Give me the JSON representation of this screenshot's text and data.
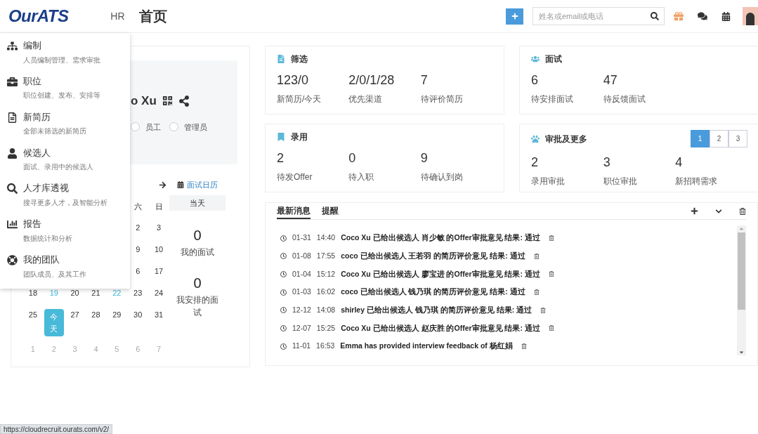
{
  "header": {
    "brand": "OurATS",
    "role": "HR",
    "title": "首页",
    "search": {
      "placeholder": "姓名或email或电话"
    }
  },
  "menu": [
    {
      "title": "编制",
      "subtitle": "人员编制管理、需求审批"
    },
    {
      "title": "职位",
      "subtitle": "职位创建、发布、安排等"
    },
    {
      "title": "新简历",
      "subtitle": "全部未筛选的新简历"
    },
    {
      "title": "候选人",
      "subtitle": "面试、录用中的候选人"
    },
    {
      "title": "人才库透视",
      "subtitle": "搜寻更多人才，及智能分析"
    },
    {
      "title": "报告",
      "subtitle": "数据统计和分析"
    },
    {
      "title": "我的团队",
      "subtitle": "团队成员、及其工作"
    }
  ],
  "profile": {
    "name": "o Xu",
    "roles": [
      {
        "label": "员工",
        "selected": false
      },
      {
        "label": "管理员",
        "selected": false
      }
    ]
  },
  "calendar": {
    "weekdays": [
      "六",
      "日"
    ],
    "weeks": [
      [
        {
          "day": "2",
          "kind": "normal"
        },
        {
          "day": "3",
          "kind": "normal"
        }
      ],
      [
        {
          "day": "9",
          "kind": "normal"
        },
        {
          "day": "10",
          "kind": "normal"
        }
      ],
      [
        {
          "day": "6",
          "kind": "normal"
        },
        {
          "day": "17",
          "kind": "normal"
        }
      ],
      [
        {
          "day": "18",
          "kind": "normal"
        },
        {
          "day": "19",
          "kind": "marked"
        },
        {
          "day": "20",
          "kind": "normal"
        },
        {
          "day": "21",
          "kind": "normal"
        },
        {
          "day": "22",
          "kind": "marked"
        },
        {
          "day": "23",
          "kind": "normal"
        },
        {
          "day": "24",
          "kind": "normal"
        }
      ],
      [
        {
          "day": "25",
          "kind": "normal"
        },
        {
          "day": "今天",
          "kind": "today"
        },
        {
          "day": "27",
          "kind": "normal"
        },
        {
          "day": "28",
          "kind": "normal"
        },
        {
          "day": "29",
          "kind": "normal"
        },
        {
          "day": "30",
          "kind": "normal"
        },
        {
          "day": "31",
          "kind": "normal"
        }
      ],
      [
        {
          "day": "1",
          "kind": "other"
        },
        {
          "day": "2",
          "kind": "other"
        },
        {
          "day": "3",
          "kind": "other"
        },
        {
          "day": "4",
          "kind": "other"
        },
        {
          "day": "5",
          "kind": "other"
        },
        {
          "day": "6",
          "kind": "other"
        },
        {
          "day": "7",
          "kind": "other"
        }
      ]
    ]
  },
  "interview_calendar": {
    "link": "面试日历",
    "tab": "当天",
    "stats": [
      {
        "value": "0",
        "label": "我的面试"
      },
      {
        "value": "0",
        "label": "我安排的面试"
      }
    ]
  },
  "cards": [
    {
      "title": "筛选",
      "stats": [
        {
          "value": "123/0",
          "label": "新简历/今天"
        },
        {
          "value": "2/0/1/28",
          "label": "优先渠道"
        },
        {
          "value": "7",
          "label": "待评价简历"
        }
      ]
    },
    {
      "title": "面试",
      "stats": [
        {
          "value": "6",
          "label": "待安排面试"
        },
        {
          "value": "47",
          "label": "待反馈面试"
        }
      ]
    },
    {
      "title": "录用",
      "stats": [
        {
          "value": "2",
          "label": "待发Offer"
        },
        {
          "value": "0",
          "label": "待入职"
        },
        {
          "value": "9",
          "label": "待确认到岗"
        }
      ]
    },
    {
      "title": "审批及更多",
      "pages": [
        {
          "label": "1",
          "selected": true
        },
        {
          "label": "2",
          "selected": false
        },
        {
          "label": "3",
          "selected": false
        }
      ],
      "stats": [
        {
          "value": "2",
          "label": "录用审批"
        },
        {
          "value": "3",
          "label": "职位审批"
        },
        {
          "value": "4",
          "label": "新招聘需求"
        }
      ]
    }
  ],
  "messages": {
    "tabs": [
      {
        "label": "最新消息",
        "selected": true
      },
      {
        "label": "提醒",
        "selected": false
      }
    ],
    "items": [
      {
        "date": "01-31",
        "time": "14:40",
        "text": "Coco Xu 已给出候选人 肖少敏 的Offer审批意见 结果: 通过"
      },
      {
        "date": "01-08",
        "time": "17:55",
        "text": "coco 已给出候选人 王若羽 的简历评价意见 结果: 通过"
      },
      {
        "date": "01-04",
        "time": "15:12",
        "text": "Coco Xu 已给出候选人 廖宝进 的Offer审批意见 结果: 通过"
      },
      {
        "date": "01-03",
        "time": "16:02",
        "text": "coco 已给出候选人 钱乃琪 的简历评价意见 结果: 通过"
      },
      {
        "date": "12-12",
        "time": "14:08",
        "text": "shirley 已给出候选人 钱乃琪 的简历评价意见 结果: 通过"
      },
      {
        "date": "12-07",
        "time": "15:25",
        "text": "Coco Xu 已给出候选人 赵庆胜 的Offer审批意见 结果: 通过"
      },
      {
        "date": "11-01",
        "time": "16:53",
        "text": "Emma has provided interview feedback of 杨红娟"
      }
    ]
  },
  "status_bar": {
    "url": "https://cloudrecruit.ourats.com/v2/"
  }
}
